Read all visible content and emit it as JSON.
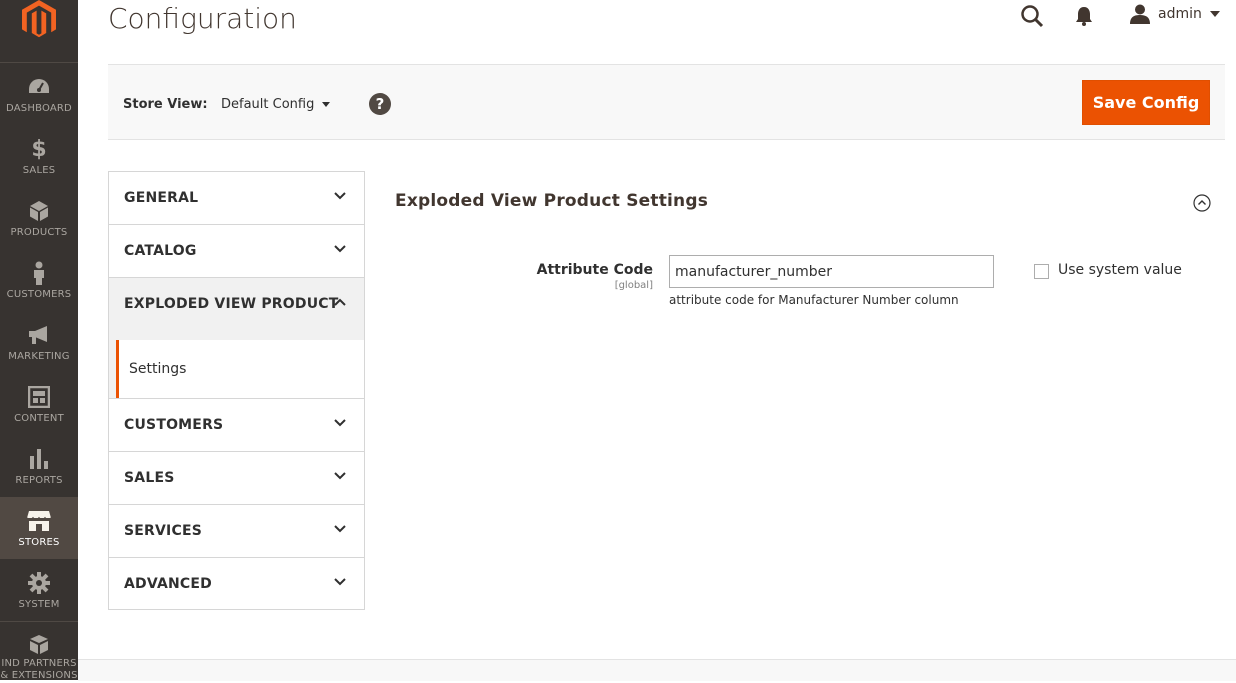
{
  "sidebar": {
    "logo_icon": "magento-logo",
    "items": [
      {
        "label": "DASHBOARD",
        "icon": "dashboard-icon"
      },
      {
        "label": "SALES",
        "icon": "dollar-icon"
      },
      {
        "label": "PRODUCTS",
        "icon": "cube-icon"
      },
      {
        "label": "CUSTOMERS",
        "icon": "person-icon"
      },
      {
        "label": "MARKETING",
        "icon": "megaphone-icon"
      },
      {
        "label": "CONTENT",
        "icon": "layout-icon"
      },
      {
        "label": "REPORTS",
        "icon": "bar-chart-icon"
      },
      {
        "label": "STORES",
        "icon": "store-icon"
      },
      {
        "label": "SYSTEM",
        "icon": "gear-icon"
      },
      {
        "label": "IND PARTNERS",
        "label2": "& EXTENSIONS",
        "icon": "blocks-icon"
      }
    ]
  },
  "header": {
    "title": "Configuration",
    "user": "admin"
  },
  "store_bar": {
    "label": "Store View:",
    "value": "Default Config",
    "help": "?",
    "save_label": "Save Config"
  },
  "tabs": {
    "general": "GENERAL",
    "catalog": "CATALOG",
    "exploded": "EXPLODED VIEW PRODUCT",
    "settings": "Settings",
    "customers": "CUSTOMERS",
    "sales": "SALES",
    "services": "SERVICES",
    "advanced": "ADVANCED"
  },
  "section": {
    "title": "Exploded View Product Settings",
    "field_label": "Attribute Code",
    "field_scope": "[global]",
    "field_value": "manufacturer_number",
    "field_note": "attribute code for Manufacturer Number column",
    "system_value_label": "Use system value",
    "system_value_checked": false
  },
  "colors": {
    "accent": "#eb5202",
    "sidebar_bg": "#373330",
    "sidebar_active": "#514943"
  }
}
